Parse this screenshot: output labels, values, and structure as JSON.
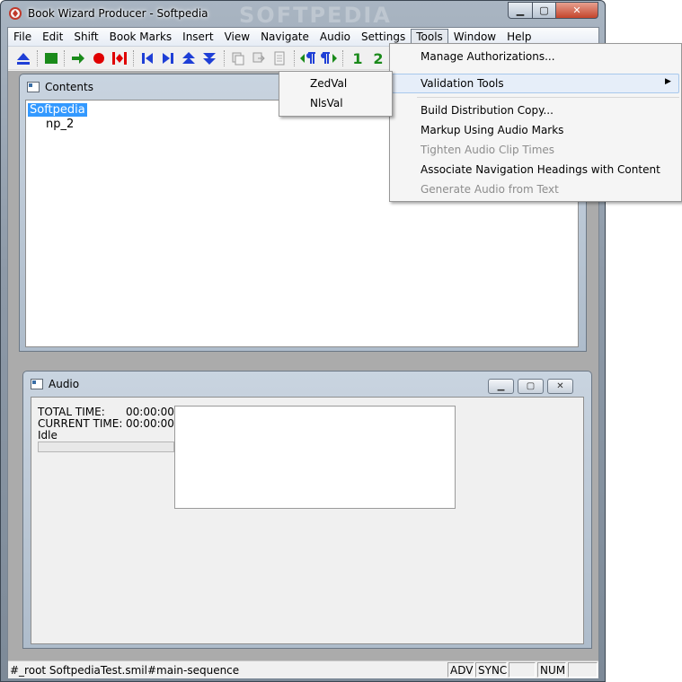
{
  "window": {
    "title": "Book Wizard Producer - Softpedia",
    "watermark": "SOFTPEDIA"
  },
  "menubar": {
    "items": [
      "File",
      "Edit",
      "Shift",
      "Book Marks",
      "Insert",
      "View",
      "Navigate",
      "Audio",
      "Settings",
      "Tools",
      "Window",
      "Help"
    ],
    "active": "Tools"
  },
  "toolbar": {
    "page_one_label": "1",
    "page_two_label": "2"
  },
  "contents": {
    "title": "Contents",
    "root": "Softpedia",
    "child": "np_2"
  },
  "audio": {
    "title": "Audio",
    "total_label": "TOTAL TIME:",
    "total_value": "00:00:00",
    "current_label": "CURRENT TIME:",
    "current_value": "00:00:00",
    "state": "Idle"
  },
  "tools_menu": {
    "items": [
      {
        "label": "Manage Authorizations...",
        "enabled": true
      },
      {
        "label": "Validation Tools",
        "enabled": true,
        "submenu": true
      },
      {
        "label": "Build Distribution Copy...",
        "enabled": true
      },
      {
        "label": "Markup Using Audio Marks",
        "enabled": true
      },
      {
        "label": "Tighten Audio Clip Times",
        "enabled": false
      },
      {
        "label": "Associate Navigation Headings with Content",
        "enabled": true
      },
      {
        "label": "Generate Audio from Text",
        "enabled": false
      }
    ]
  },
  "validation_submenu": {
    "items": [
      "ZedVal",
      "NlsVal"
    ]
  },
  "statusbar": {
    "text": "#_root SoftpediaTest.smil#main-sequence",
    "panels": [
      "ADV",
      "SYNC",
      "",
      "NUM"
    ]
  },
  "colors": {
    "selection": "#3399ff",
    "toolbar_blue": "#1f3fd6",
    "toolbar_green": "#1a8a1a",
    "toolbar_red": "#e00000"
  }
}
